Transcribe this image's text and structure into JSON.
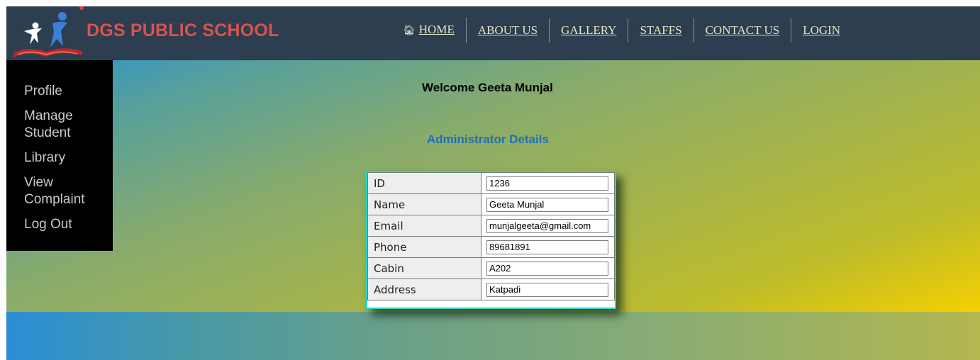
{
  "header": {
    "brand": "DGS PUBLIC SCHOOL",
    "nav": [
      "HOME",
      "ABOUT US",
      "GALLERY",
      "STAFFS",
      "CONTACT US",
      "LOGIN"
    ],
    "home_icon": "home-icon"
  },
  "sidebar": {
    "items": [
      {
        "label": "Profile"
      },
      {
        "label": "Manage Student"
      },
      {
        "label": "Library"
      },
      {
        "label": "View Complaint"
      },
      {
        "label": "Log Out"
      }
    ]
  },
  "main": {
    "welcome": "Welcome Geeta Munjal",
    "details_title": "Administrator Details",
    "rows": [
      {
        "label": "ID",
        "value": "1236"
      },
      {
        "label": "Name",
        "value": "Geeta Munjal"
      },
      {
        "label": "Email",
        "value": "munjalgeeta@gmail.com"
      },
      {
        "label": "Phone",
        "value": "89681891"
      },
      {
        "label": "Cabin",
        "value": "A202"
      },
      {
        "label": "Address",
        "value": "Katpadi"
      }
    ]
  },
  "colors": {
    "header_bg": "#2c3e50",
    "brand": "#d9534f",
    "nav_link": "#e8e4c4",
    "sidebar_bg": "#000000",
    "details_title": "#1e6fb8",
    "table_border": "#20d8c8"
  }
}
